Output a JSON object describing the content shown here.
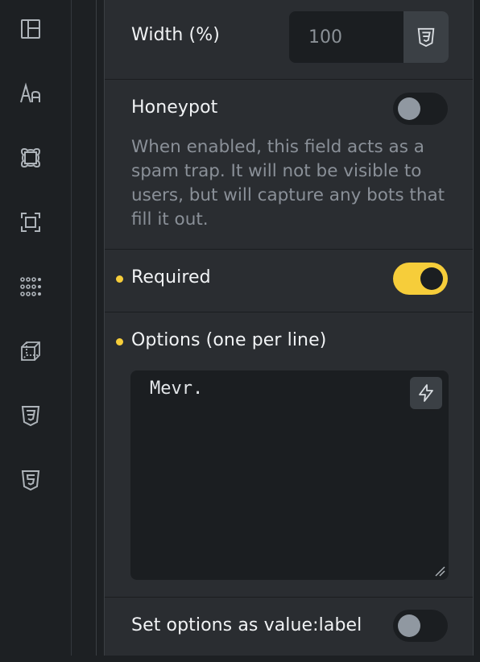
{
  "sidebar": {
    "icons": [
      "layout-icon",
      "typography-icon",
      "spacing-icon",
      "border-icon",
      "grid-dots-icon",
      "3d-box-icon",
      "css3-icon",
      "html5-icon"
    ]
  },
  "width_field": {
    "label": "Width (%)",
    "value": "100"
  },
  "honeypot": {
    "label": "Honeypot",
    "enabled": false,
    "description": "When enabled, this field acts as a spam trap. It will not be visible to users, but will capture any bots that fill it out."
  },
  "required": {
    "label": "Required",
    "enabled": true
  },
  "options": {
    "label": "Options (one per line)",
    "value": "Mevr."
  },
  "value_label": {
    "label": "Set options as value:label",
    "enabled": false
  },
  "colors": {
    "accent": "#f6cd3a",
    "panel": "#2a2d31",
    "sidebar": "#1d2023",
    "input_bg": "#1b1e21"
  }
}
